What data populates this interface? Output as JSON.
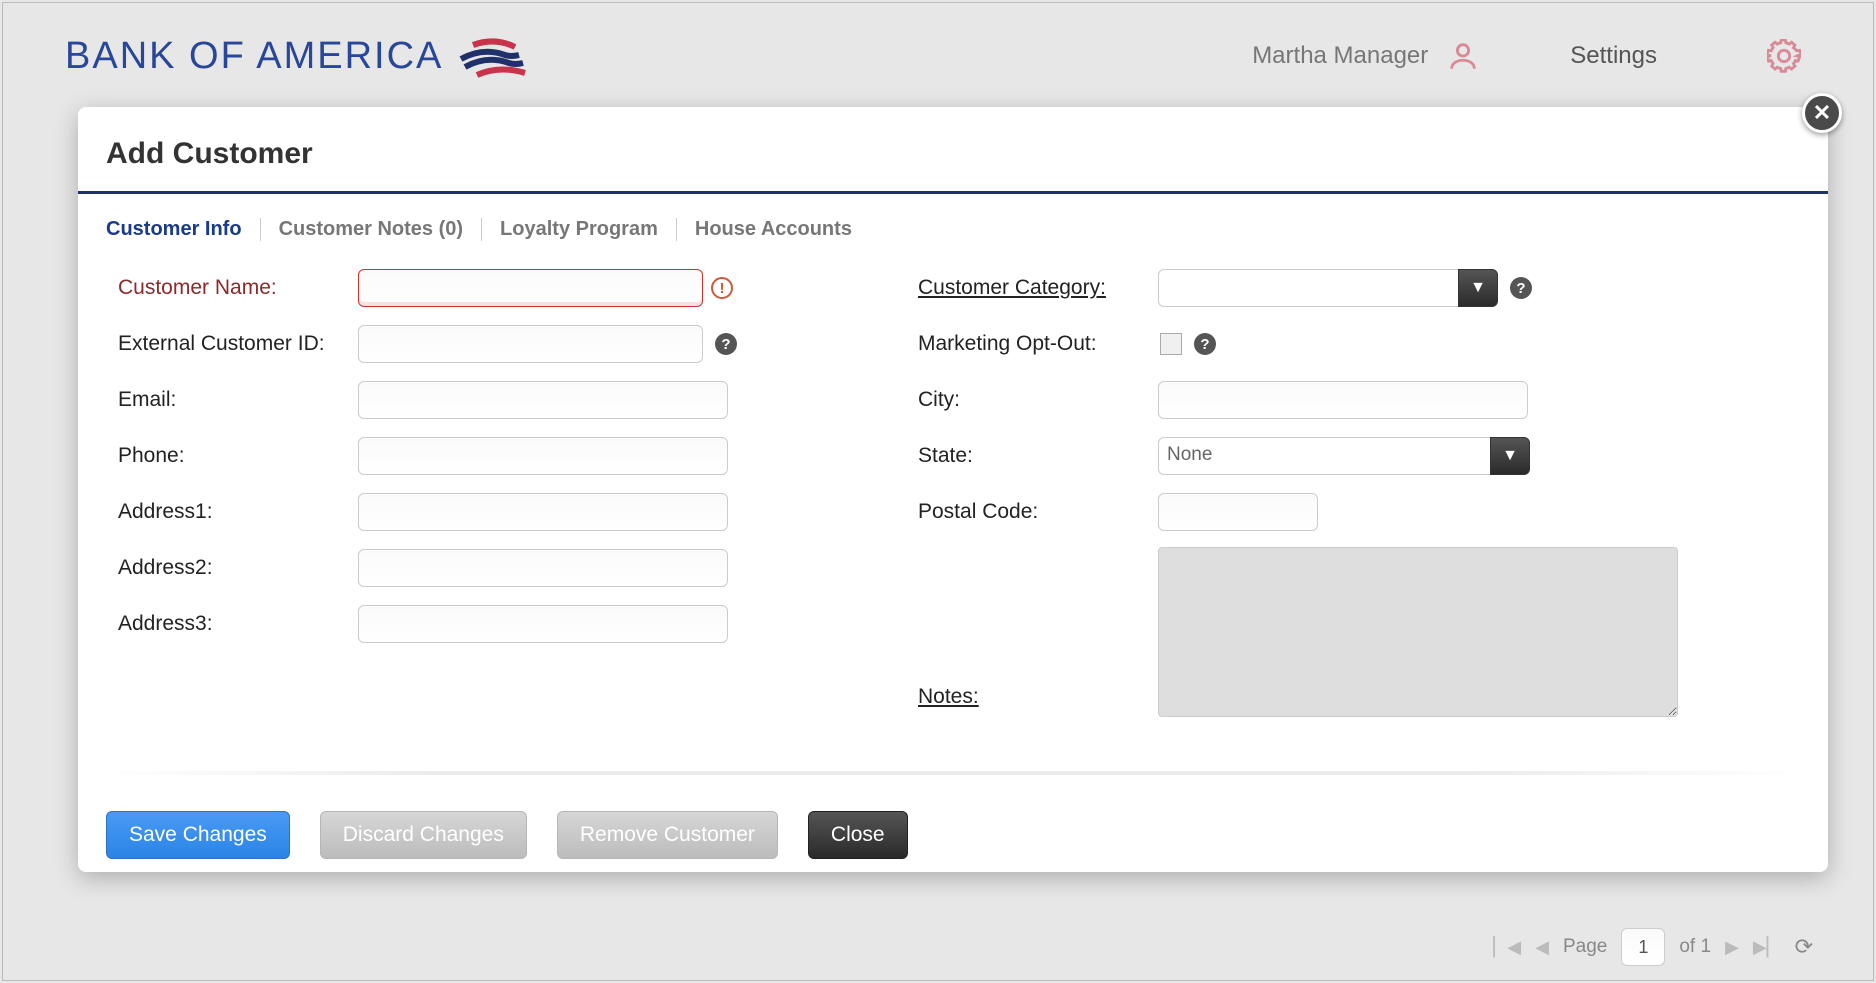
{
  "header": {
    "brand": "BANK OF AMERICA",
    "user": "Martha Manager",
    "settings": "Settings"
  },
  "modal": {
    "title": "Add Customer",
    "tabs": [
      "Customer Info",
      "Customer Notes (0)",
      "Loyalty Program",
      "House Accounts"
    ],
    "left": {
      "customer_name": "Customer Name:",
      "external_id": "External Customer ID:",
      "email": "Email:",
      "phone": "Phone:",
      "addr1": "Address1:",
      "addr2": "Address2:",
      "addr3": "Address3:"
    },
    "right": {
      "category": "Customer Category:",
      "optout": "Marketing Opt-Out:",
      "city": "City:",
      "state": "State:",
      "state_value": "None",
      "postal": "Postal Code:",
      "notes": "Notes:"
    },
    "buttons": {
      "save": "Save Changes",
      "discard": "Discard Changes",
      "remove": "Remove Customer",
      "close": "Close"
    }
  },
  "pager": {
    "page_label": "Page",
    "page": "1",
    "of": "of 1"
  }
}
